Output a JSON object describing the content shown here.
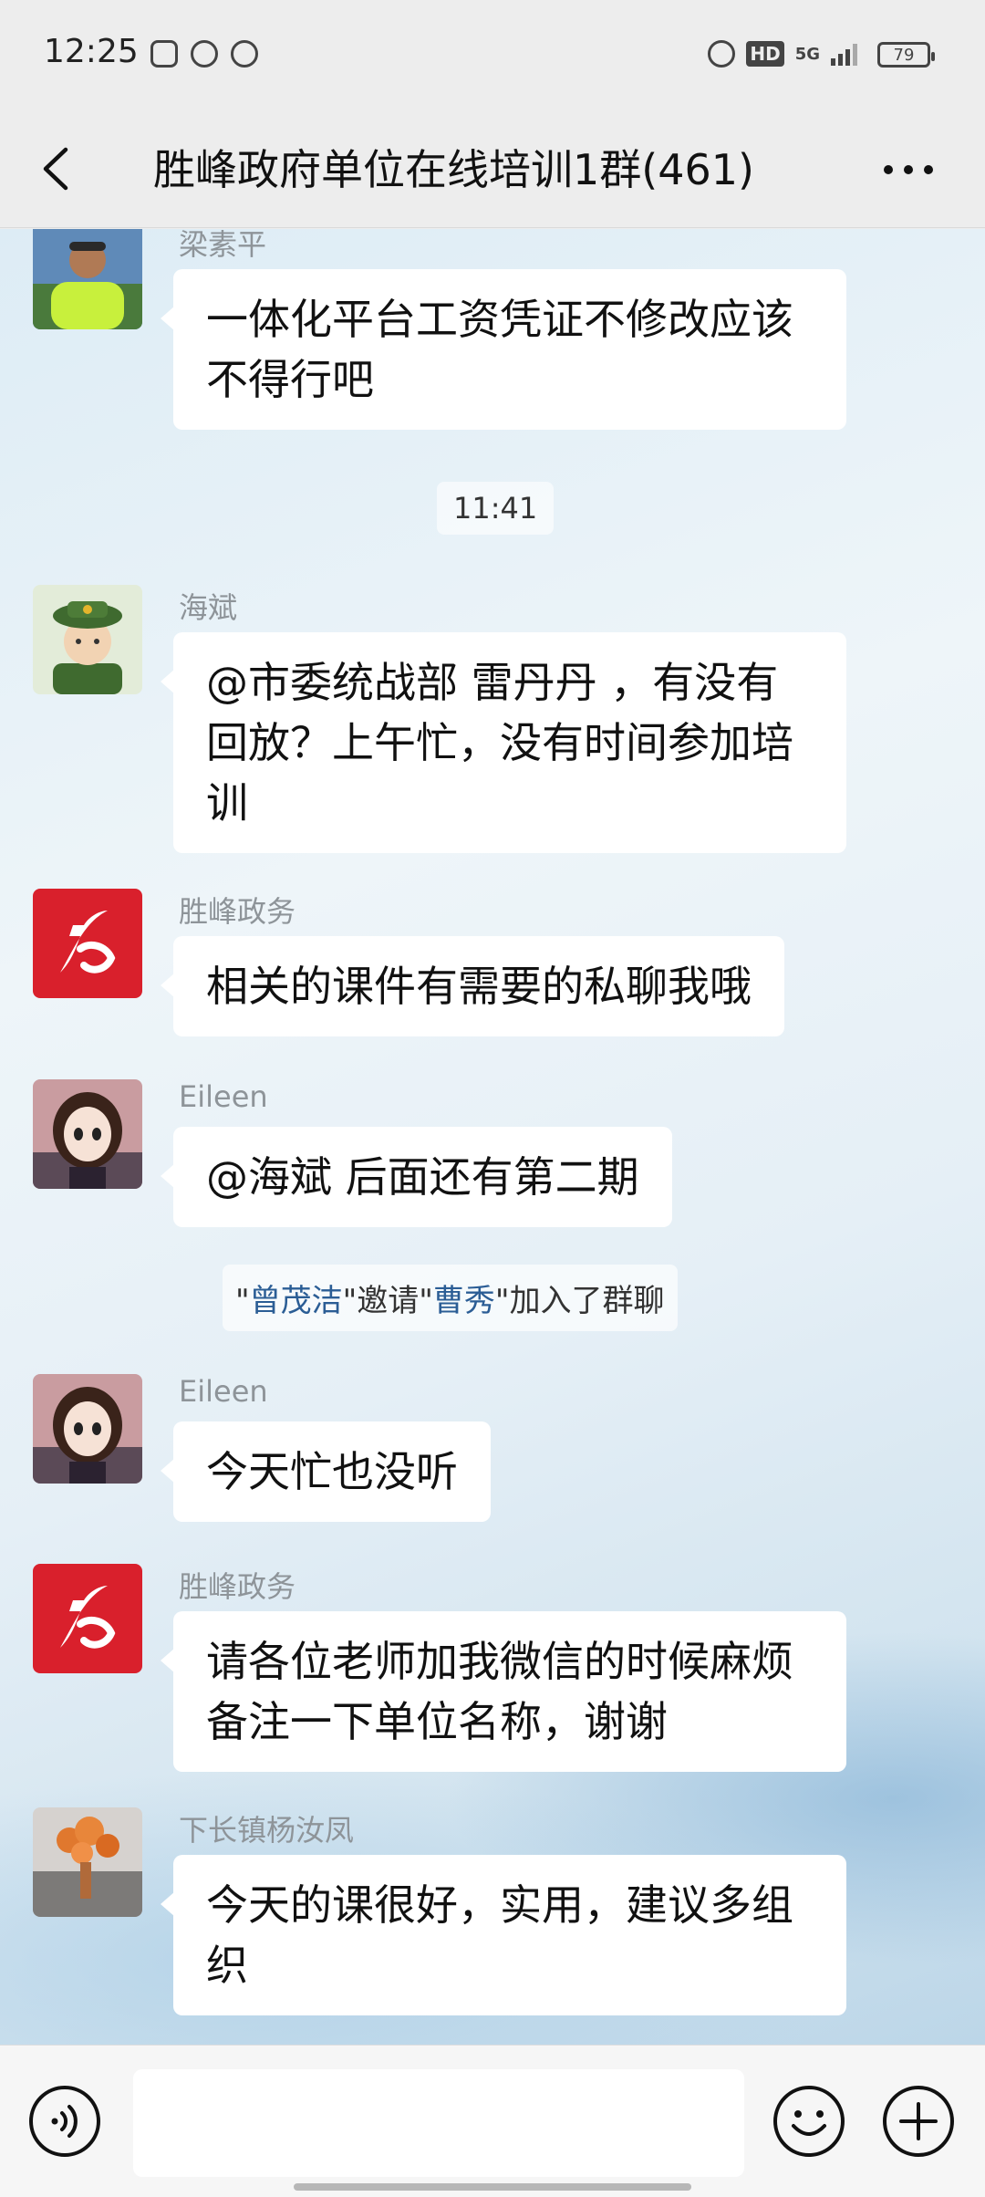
{
  "status_bar": {
    "time": "12:25",
    "hd": "HD",
    "network": "5G",
    "battery": "79"
  },
  "header": {
    "title": "胜峰政府单位在线培训1群(461)",
    "back_icon": "chevron-left-icon",
    "more_icon": "more-horizontal-icon"
  },
  "messages": [
    {
      "sender": "梁素平",
      "text": "一体化平台工资凭证不修改应该不得行吧"
    },
    {
      "time": "11:41"
    },
    {
      "sender": "海斌",
      "text": "@市委统战部 雷丹丹 ，有没有回放？上午忙，没有时间参加培训"
    },
    {
      "sender": "胜峰政务",
      "text": "相关的课件有需要的私聊我哦"
    },
    {
      "sender": "Eileen",
      "text": "@海斌  后面还有第二期"
    },
    {
      "system": {
        "inviter": "曾茂洁",
        "invite_word": "邀请",
        "invitee": "曹秀",
        "suffix": "加入了群聊"
      }
    },
    {
      "sender": "Eileen",
      "text": "今天忙也没听"
    },
    {
      "sender": "胜峰政务",
      "text": "请各位老师加我微信的时候麻烦备注一下单位名称，谢谢"
    },
    {
      "sender": "下长镇杨汝凤",
      "text": "今天的课很好，实用，建议多组织"
    }
  ],
  "system_quote": "\"",
  "input_bar": {
    "voice_icon": "voice-icon",
    "emoji_icon": "emoji-icon",
    "plus_icon": "plus-icon",
    "input_value": ""
  },
  "colors": {
    "bubble": "#ffffff",
    "sender_name": "#8e9499",
    "system_name": "#2b5d95",
    "shengfeng_logo": "#d9202c"
  }
}
